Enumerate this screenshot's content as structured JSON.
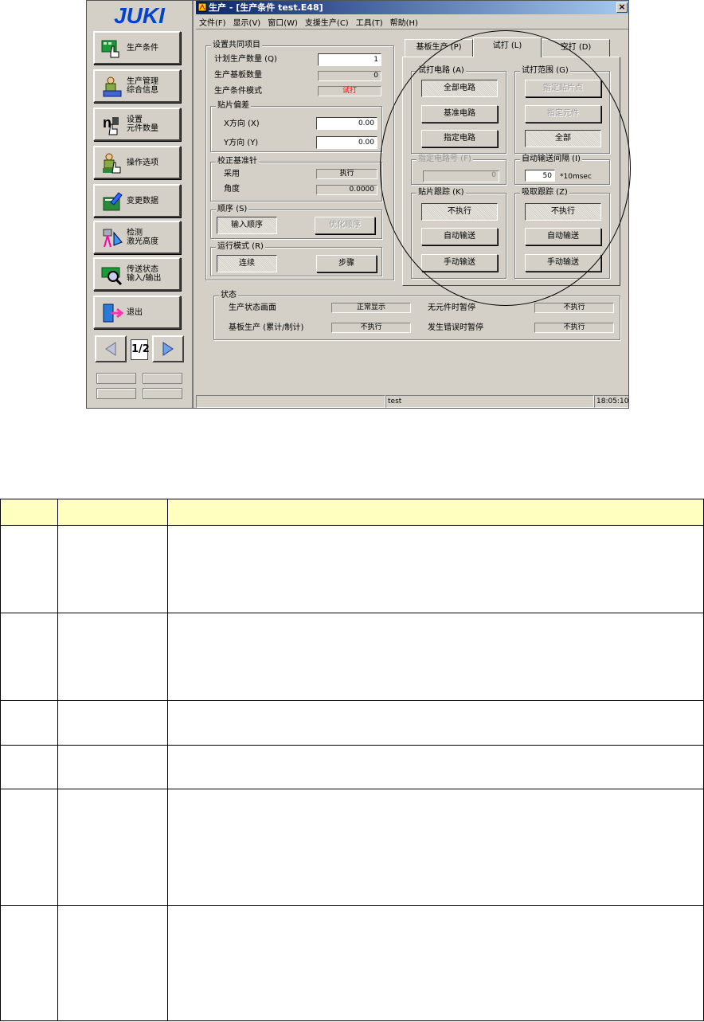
{
  "left_panel": {
    "logo_text": "JUKI",
    "buttons": [
      {
        "label": "生产条件",
        "icon": "green-board-hand-icon"
      },
      {
        "label": "生产管理\n综合信息",
        "icon": "person-info-icon"
      },
      {
        "label": "设置\n元件数量",
        "icon": "count-hand-icon"
      },
      {
        "label": "操作选项",
        "icon": "person-hand-icon"
      },
      {
        "label": "变更数据",
        "icon": "pen-book-icon"
      },
      {
        "label": "检测\n激光高度",
        "icon": "laser-height-icon"
      },
      {
        "label": "传送状态\n输入/输出",
        "icon": "conveyor-magnifier-icon"
      },
      {
        "label": "退出",
        "icon": "exit-door-icon"
      }
    ],
    "page_indicator": "1/2"
  },
  "window": {
    "title": "生产 - [生产条件 test.E48]",
    "close": "×",
    "menu": [
      "文件(F)",
      "显示(V)",
      "窗口(W)",
      "支援生产(C)",
      "工具(T)",
      "帮助(H)"
    ],
    "status_bar": {
      "text": "test",
      "time": "18:05:10"
    }
  },
  "common": {
    "group_title": "设置共同项目",
    "planned_qty_label": "计划生产数量 (Q)",
    "planned_qty_value": "1",
    "board_count_label": "生产基板数量",
    "board_count_value": "0",
    "mode_label": "生产条件模式",
    "mode_value": "试打"
  },
  "offset": {
    "group_title": "贴片偏差",
    "x_label": "X方向 (X)",
    "x_value": "0.00",
    "y_label": "Y方向 (Y)",
    "y_value": "0.00"
  },
  "calib": {
    "group_title": "校正基准针",
    "use_label": "采用",
    "use_value": "执行",
    "angle_label": "角度",
    "angle_value": "0.0000"
  },
  "order": {
    "group_title": "顺序 (S)",
    "input_order": "输入顺序",
    "optimize_order": "优化顺序"
  },
  "run_mode": {
    "group_title": "运行模式 (R)",
    "continuous": "连续",
    "step": "步骤"
  },
  "tabs": [
    "基板生产 (P)",
    "试打 (L)",
    "空打 (D)"
  ],
  "trial": {
    "circuit_title": "试打电路 (A)",
    "all_circuits": "全部电路",
    "ref_circuit": "基准电路",
    "specified_circuit": "指定电路",
    "range_title": "试打范围 (G)",
    "specified_point": "指定贴片点",
    "specified_part": "指定元件",
    "all": "全部",
    "circuit_no_title": "指定电路号 (F)",
    "circuit_no_value": "0",
    "auto_interval_title": "自动输送间隔 (I)",
    "auto_interval_value": "50",
    "auto_interval_unit": "*10msec",
    "trace_title": "贴片跟踪 (K)",
    "trace_not_exec": "不执行",
    "trace_auto": "自动输送",
    "trace_manual": "手动输送",
    "pick_title": "吸取跟踪 (Z)",
    "pick_not_exec": "不执行",
    "pick_auto": "自动输送",
    "pick_manual": "手动输送"
  },
  "status": {
    "group_title": "状态",
    "screen_label": "生产状态画面",
    "screen_value": "正常显示",
    "no_part_label": "无元件时暂停",
    "no_part_value": "不执行",
    "board_prod_label": "基板生产 (累计/制计)",
    "board_prod_value": "不执行",
    "error_label": "发生错误时暂停",
    "error_value": "不执行"
  },
  "colors": {
    "title_bar_start": "#0a246a",
    "mode_value": "#ff0000",
    "table_header": "#ffffc0"
  }
}
